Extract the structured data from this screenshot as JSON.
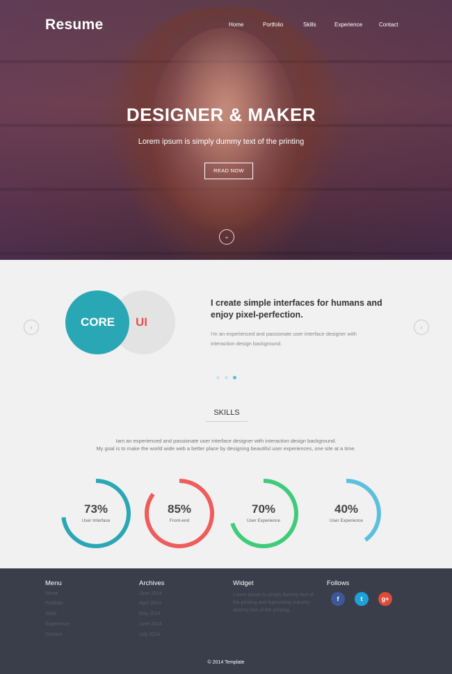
{
  "header": {
    "logo": "Resume",
    "nav": [
      "Home",
      "Portfolio",
      "Skills",
      "Experience",
      "Contact"
    ]
  },
  "hero": {
    "title": "DESIGNER & MAKER",
    "subtitle": "Lorem ipsum is simply dummy text of the printing",
    "button": "READ NOW",
    "scroll_icon": "chevron-down-icon"
  },
  "about": {
    "core_label": "CORE",
    "ui_label": "UI",
    "title": "I create simple interfaces for humans and enjoy pixel-perfection.",
    "text": "I'm an experienced and passionate user interface designer with interaction design background.",
    "prev_icon": "chevron-left-icon",
    "next_icon": "chevron-right-icon",
    "slides": 3,
    "active_slide": 3
  },
  "skills": {
    "title": "SKILLS",
    "desc_line1": "Iam an experienced and passionate user interface designer with interaction design background.",
    "desc_line2": "My goal is to make the world wide web a better place by designing beautiful user experiences, one site at a time.",
    "items": [
      {
        "percent": "73%",
        "value": 0.73,
        "label": "User Interface",
        "color": "#2aa7b5"
      },
      {
        "percent": "85%",
        "value": 0.85,
        "label": "Front-end",
        "color": "#ef5c5c"
      },
      {
        "percent": "70%",
        "value": 0.7,
        "label": "User Experience",
        "color": "#3fcc7a"
      },
      {
        "percent": "40%",
        "value": 0.4,
        "label": "User Experience",
        "color": "#5bc0de"
      }
    ]
  },
  "footer": {
    "menu_title": "Menu",
    "menu_items": [
      "Home",
      "Portfolio",
      "Skills",
      "Experience",
      "Contact"
    ],
    "archives_title": "Archives",
    "archive_items": [
      "June 2014",
      "April 2014",
      "May 2014",
      "June 2014",
      "July 2014"
    ],
    "widget_title": "Widget",
    "widget_text": "Lorem Ipsum is simply dummy text of the printing and typesetting industry dummy text of the printing.",
    "follows_title": "Follows",
    "social": [
      {
        "name": "facebook-icon",
        "glyph": "f",
        "color": "#3b5998"
      },
      {
        "name": "twitter-icon",
        "glyph": "t",
        "color": "#1da1d8"
      },
      {
        "name": "google-plus-icon",
        "glyph": "g+",
        "color": "#dd4b39"
      }
    ],
    "copyright": "© 2014 Template"
  }
}
